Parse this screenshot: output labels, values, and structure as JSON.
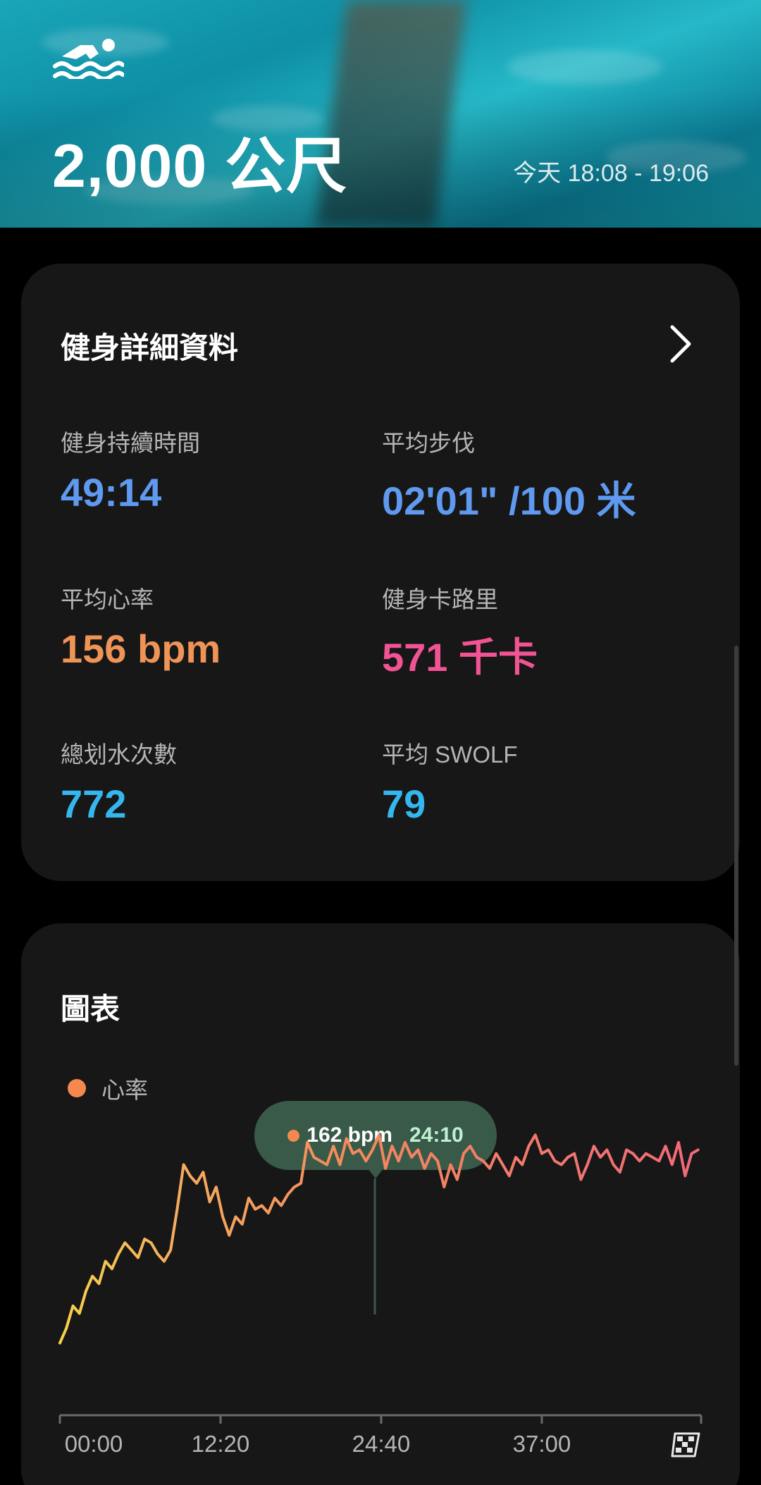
{
  "hero": {
    "distance": "2,000 公尺",
    "time_range": "今天 18:08 - 19:06",
    "icon": "swimmer-icon"
  },
  "details": {
    "title": "健身詳細資料",
    "stats": [
      {
        "label": "健身持續時間",
        "value": "49:14",
        "color": "#5f9af0"
      },
      {
        "label": "平均步伐",
        "value": "02'01\" /100 米",
        "color": "#5f9af0"
      },
      {
        "label": "平均心率",
        "value": "156 bpm",
        "color": "#ee9457"
      },
      {
        "label": "健身卡路里",
        "value": "571 千卡",
        "color": "#f25395"
      },
      {
        "label": "總划水次數",
        "value": "772",
        "color": "#34b6ee"
      },
      {
        "label": "平均 SWOLF",
        "value": "79",
        "color": "#34b6ee"
      }
    ]
  },
  "chart_card": {
    "title": "圖表",
    "legend": "心率",
    "tooltip_bpm": "162 bpm",
    "tooltip_time": "24:10"
  },
  "chart_data": {
    "type": "line",
    "series": [
      {
        "name": "心率",
        "x_minutes": [
          0,
          0.5,
          1,
          1.5,
          2,
          2.5,
          3,
          3.5,
          4,
          4.5,
          5,
          5.5,
          6,
          6.5,
          7,
          7.5,
          8,
          8.5,
          9,
          9.5,
          10,
          10.5,
          11,
          11.5,
          12,
          12.5,
          13,
          13.5,
          14,
          14.5,
          15,
          15.5,
          16,
          16.5,
          17,
          17.5,
          18,
          18.5,
          19,
          19.5,
          20,
          20.5,
          21,
          21.5,
          22,
          22.5,
          23,
          23.5,
          24,
          24.5,
          25,
          25.5,
          26,
          26.5,
          27,
          27.5,
          28,
          28.5,
          29,
          29.5,
          30,
          30.5,
          31,
          31.5,
          32,
          32.5,
          33,
          33.5,
          34,
          34.5,
          35,
          35.5,
          36,
          36.5,
          37,
          37.5,
          38,
          38.5,
          39,
          39.5,
          40,
          40.5,
          41,
          41.5,
          42,
          42.5,
          43,
          43.5,
          44,
          44.5,
          45,
          45.5,
          46,
          46.5,
          47,
          47.5,
          48,
          48.5,
          49
        ],
        "values": [
          106,
          110,
          116,
          114,
          120,
          124,
          122,
          128,
          126,
          130,
          133,
          131,
          129,
          134,
          133,
          130,
          128,
          131,
          142,
          154,
          151,
          149,
          152,
          144,
          148,
          140,
          135,
          140,
          138,
          145,
          142,
          143,
          141,
          145,
          143,
          146,
          148,
          149,
          160,
          156,
          155,
          154,
          159,
          154,
          161,
          157,
          158,
          155,
          158,
          162,
          153,
          159,
          155,
          160,
          156,
          158,
          153,
          157,
          155,
          148,
          154,
          150,
          157,
          159,
          156,
          155,
          153,
          157,
          154,
          151,
          156,
          154,
          159,
          162,
          157,
          158,
          155,
          154,
          156,
          157,
          150,
          154,
          159,
          156,
          158,
          154,
          152,
          158,
          157,
          155,
          157,
          156,
          155,
          159,
          154,
          160,
          151,
          157,
          158
        ]
      }
    ],
    "x_ticks": [
      "00:00",
      "12:20",
      "24:40",
      "37:00"
    ],
    "xlim": [
      0,
      49.23
    ],
    "ylim": [
      90,
      200
    ],
    "grid": false,
    "legend_position": "top-left"
  }
}
